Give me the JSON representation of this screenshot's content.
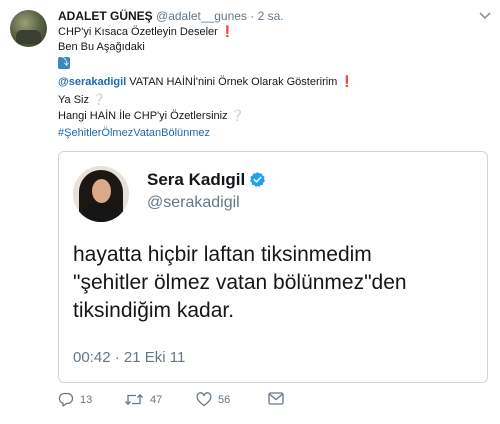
{
  "tweet": {
    "display_name": "ADALET GÜNEŞ",
    "handle": "@adalet__gunes",
    "separator": "·",
    "time": "2 sa.",
    "lines": {
      "l1": "CHP'yi Kısaca Özetleyin Deseler",
      "l1_emoji": "❗",
      "l2": "Ben Bu Aşağıdaki",
      "l3_emoji": "⤵",
      "l4_mention": "@serakadigil",
      "l4_text": " VATAN HAİNİ'nini Örnek Olarak Gösteririm",
      "l4_emoji": "❗",
      "l5": "Ya Siz",
      "l5_emoji": "❔",
      "l6": "Hangi HAİN İle CHP'yi Özetlersiniz",
      "l6_emoji": "❔",
      "l7_hashtag": "#ŞehitlerÖlmezVatanBölünmez"
    }
  },
  "quoted": {
    "name": "Sera Kadıgil",
    "handle": "@serakadigil",
    "text_lines": [
      "hayatta hiçbir laftan tiksinmedim",
      "\"şehitler ölmez vatan bölünmez\"den",
      "tiksindiğim kadar."
    ],
    "timestamp": "00:42 · 21 Eki 11"
  },
  "actions": {
    "replies": "13",
    "retweets": "47",
    "likes": "56"
  },
  "icons": {
    "caret": "chevron-down-icon",
    "verified": "verified-badge-icon",
    "reply": "reply-icon",
    "retweet": "retweet-icon",
    "like": "heart-icon",
    "dm": "envelope-icon"
  },
  "colors": {
    "link": "#1b6ab0",
    "muted": "#657786",
    "verified": "#1da1f2",
    "exclamation": "#e0245e"
  }
}
